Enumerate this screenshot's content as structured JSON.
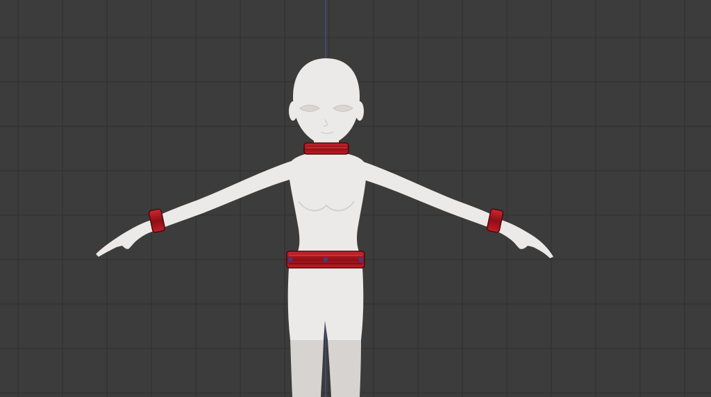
{
  "viewport": {
    "background": "#3c3c3c",
    "grid_color": "#2e2e2e",
    "axis_color": "#4a4f9a"
  },
  "model": {
    "skin_color": "#eceae8",
    "skin_shadow": "#d6d3d0",
    "accessory_color": "#b2141c",
    "accessory_dark": "#5a0a0e",
    "stud_color": "#4a3a7a",
    "accessories": [
      "collar",
      "left-wrist-cuff",
      "right-wrist-cuff",
      "waist-belt"
    ]
  }
}
